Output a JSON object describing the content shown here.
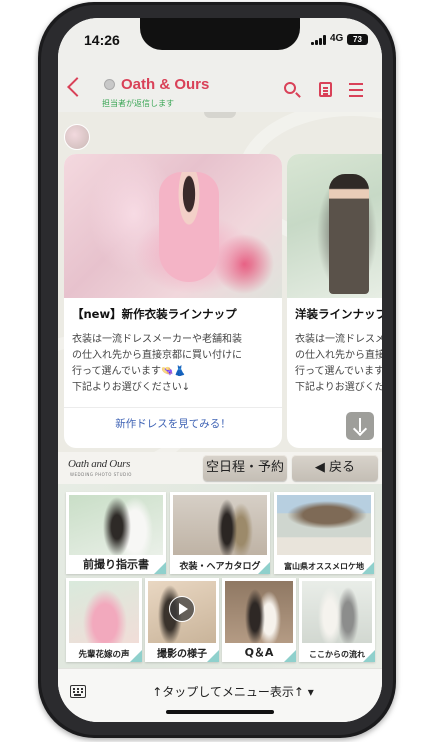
{
  "status_bar": {
    "time": "14:26",
    "network": "4G",
    "battery": "73"
  },
  "header": {
    "title": "Oath & Ours",
    "subtitle": "担当者が返信します"
  },
  "cards": [
    {
      "title": "【new】新作衣装ラインナップ",
      "body": "衣装は一流ドレスメーカーや老舗和装\nの仕入れ先から直接京都に買い付けに\n行って選んでいます👒👗\n下記よりお選びください↓",
      "link": "新作ドレスを見てみる！"
    },
    {
      "title": "洋装ラインナップ",
      "body": "衣装は一流ドレスメーカー\nの仕入れ先から直接京都\n行って選んでいます\n下記よりお選びください↓"
    }
  ],
  "rich_menu": {
    "logo": "Oath and Ours",
    "logo_sub": "WEDDING PHOTO STUDIO",
    "reserve_button": "空日程・予約",
    "back_button": "◀ 戻る",
    "tiles": [
      "前撮り指示書",
      "衣装・ヘアカタログ",
      "富山県オススメロケ地",
      "先輩花嫁の声",
      "撮影の様子",
      "Q＆A",
      "ここからの流れ"
    ]
  },
  "bottom_bar": {
    "menu_toggle": "↑タップしてメニュー表示↑ ▾"
  },
  "colors": {
    "accent": "#d94158",
    "link": "#3f63b5",
    "status_green": "#3aa655",
    "tile_corner": "#8fd0cc"
  }
}
